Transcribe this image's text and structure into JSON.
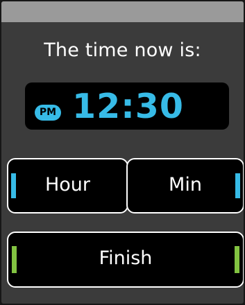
{
  "header": {
    "title": "The time now is:"
  },
  "clock": {
    "period": "PM",
    "time": "12:30"
  },
  "buttons": {
    "hour": "Hour",
    "minute": "Min",
    "finish": "Finish"
  },
  "colors": {
    "background": "#3b3b3b",
    "status_strip": "#9a9a9a",
    "time_blue": "#37bbe7",
    "finish_green": "#82c341",
    "button_fill": "#000000",
    "button_border": "#ffffff"
  }
}
